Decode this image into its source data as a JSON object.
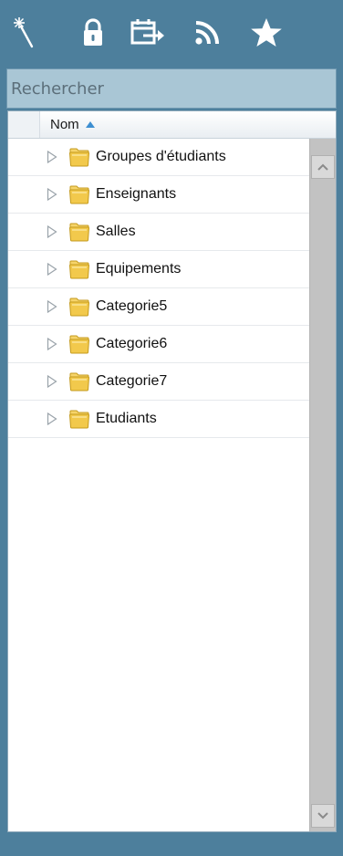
{
  "toolbar": {
    "icons": [
      "magic-wand-icon",
      "lock-icon",
      "calendar-export-icon",
      "rss-icon",
      "star-icon"
    ]
  },
  "search": {
    "placeholder": "Rechercher"
  },
  "tree": {
    "column_header": "Nom",
    "items": [
      {
        "label": "Groupes d'étudiants"
      },
      {
        "label": "Enseignants"
      },
      {
        "label": "Salles"
      },
      {
        "label": "Equipements"
      },
      {
        "label": "Categorie5"
      },
      {
        "label": "Categorie6"
      },
      {
        "label": "Categorie7"
      },
      {
        "label": "Etudiants"
      }
    ]
  },
  "colors": {
    "background": "#4d7f9c",
    "search_bg": "#a9c6d5",
    "sort_arrow": "#3d8fd1",
    "folder": "#f2c94c"
  }
}
